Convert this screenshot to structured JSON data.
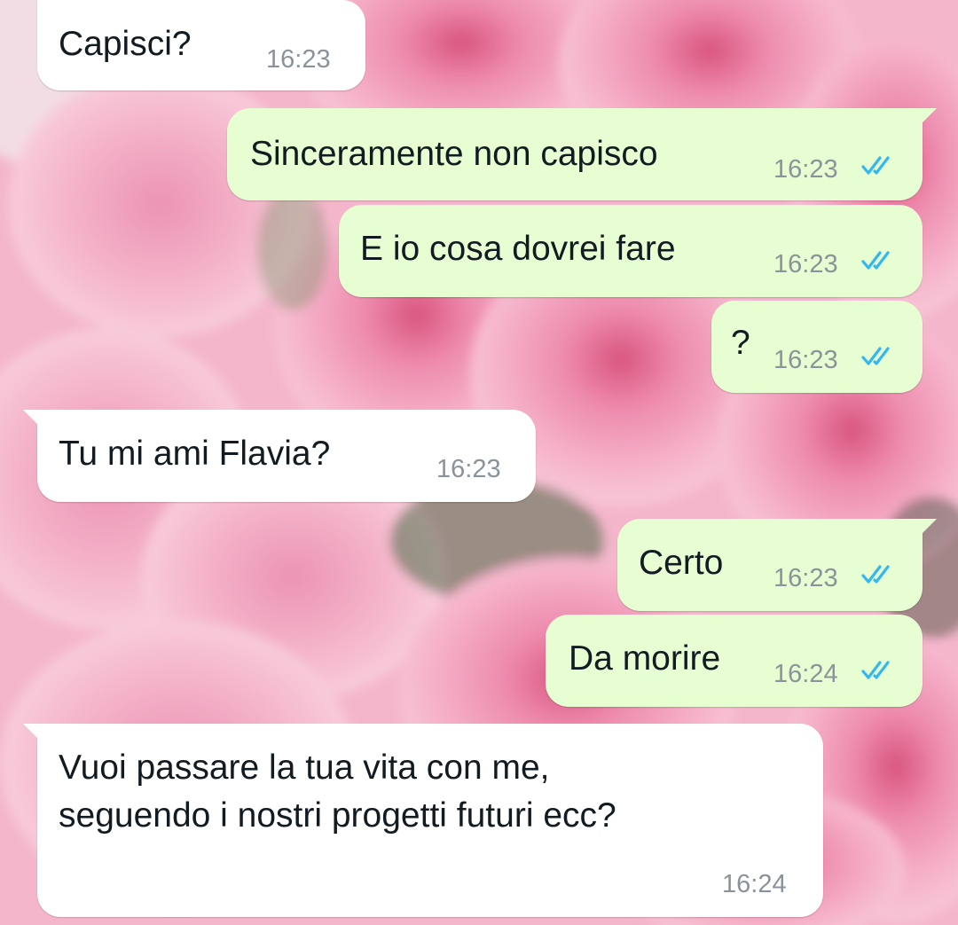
{
  "colors": {
    "incoming_bubble": "#ffffff",
    "outgoing_bubble": "#e7fed3",
    "text": "#111b21",
    "timestamp": "#8a9399",
    "read_ticks": "#34b7f1"
  },
  "wallpaper": {
    "subject": "pink-roses"
  },
  "messages": [
    {
      "direction": "incoming",
      "text": "Capisci?",
      "time": "16:23"
    },
    {
      "direction": "outgoing",
      "text": "Sinceramente non capisco",
      "time": "16:23",
      "status": "read"
    },
    {
      "direction": "outgoing",
      "text": "E io cosa dovrei fare",
      "time": "16:23",
      "status": "read"
    },
    {
      "direction": "outgoing",
      "text": "?",
      "time": "16:23",
      "status": "read"
    },
    {
      "direction": "incoming",
      "text": "Tu mi ami Flavia?",
      "time": "16:23"
    },
    {
      "direction": "outgoing",
      "text": "Certo",
      "time": "16:23",
      "status": "read"
    },
    {
      "direction": "outgoing",
      "text": "Da morire",
      "time": "16:24",
      "status": "read"
    },
    {
      "direction": "incoming",
      "text_lines": [
        "Vuoi passare la tua vita con me,",
        "seguendo i nostri progetti futuri ecc?"
      ],
      "time": "16:24"
    }
  ]
}
